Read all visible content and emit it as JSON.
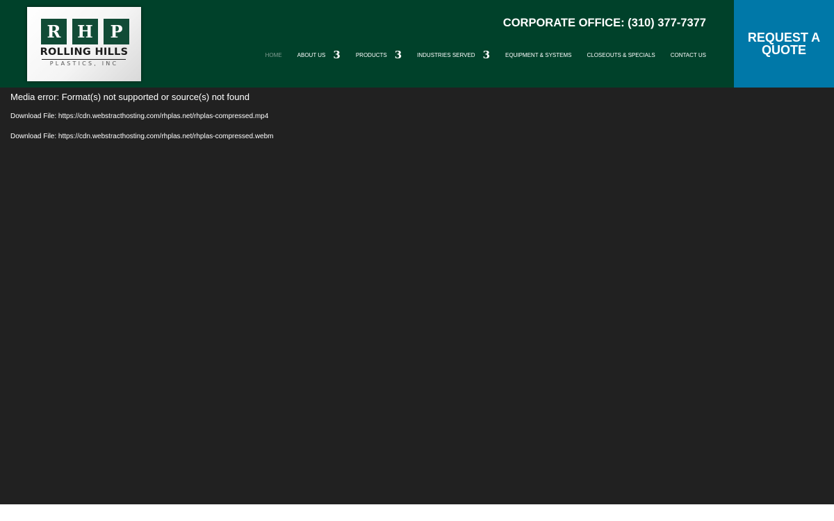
{
  "logo": {
    "letters": [
      "R",
      "H",
      "P"
    ],
    "name": "ROLLING HILLS",
    "subtitle": "PLASTICS, INC"
  },
  "header": {
    "corporate_office": "CORPORATE OFFICE: (310) 377-7377"
  },
  "nav": {
    "caret_glyph": "3",
    "items": [
      {
        "label": "HOME",
        "active": true,
        "has_dropdown": false
      },
      {
        "label": "ABOUT US",
        "active": false,
        "has_dropdown": true
      },
      {
        "label": "PRODUCTS",
        "active": false,
        "has_dropdown": true
      },
      {
        "label": "INDUSTRIES SERVED",
        "active": false,
        "has_dropdown": true
      },
      {
        "label": "EQUIPMENT & SYSTEMS",
        "active": false,
        "has_dropdown": false
      },
      {
        "label": "CLOSEOUTS & SPECIALS",
        "active": false,
        "has_dropdown": false
      },
      {
        "label": "CONTACT US",
        "active": false,
        "has_dropdown": false
      }
    ]
  },
  "quote_button": {
    "label": "REQUEST A QUOTE"
  },
  "media": {
    "error": "Media error: Format(s) not supported or source(s) not found",
    "downloads": [
      "Download File: https://cdn.webstracthosting.com/rhplas.net/rhplas-compressed.mp4",
      "Download File: https://cdn.webstracthosting.com/rhplas.net/rhplas-compressed.webm"
    ]
  },
  "colors": {
    "header_bg": "#00412a",
    "quote_bg": "#0078a8",
    "media_bg": "#212121",
    "nav_active": "#7f9c91"
  }
}
